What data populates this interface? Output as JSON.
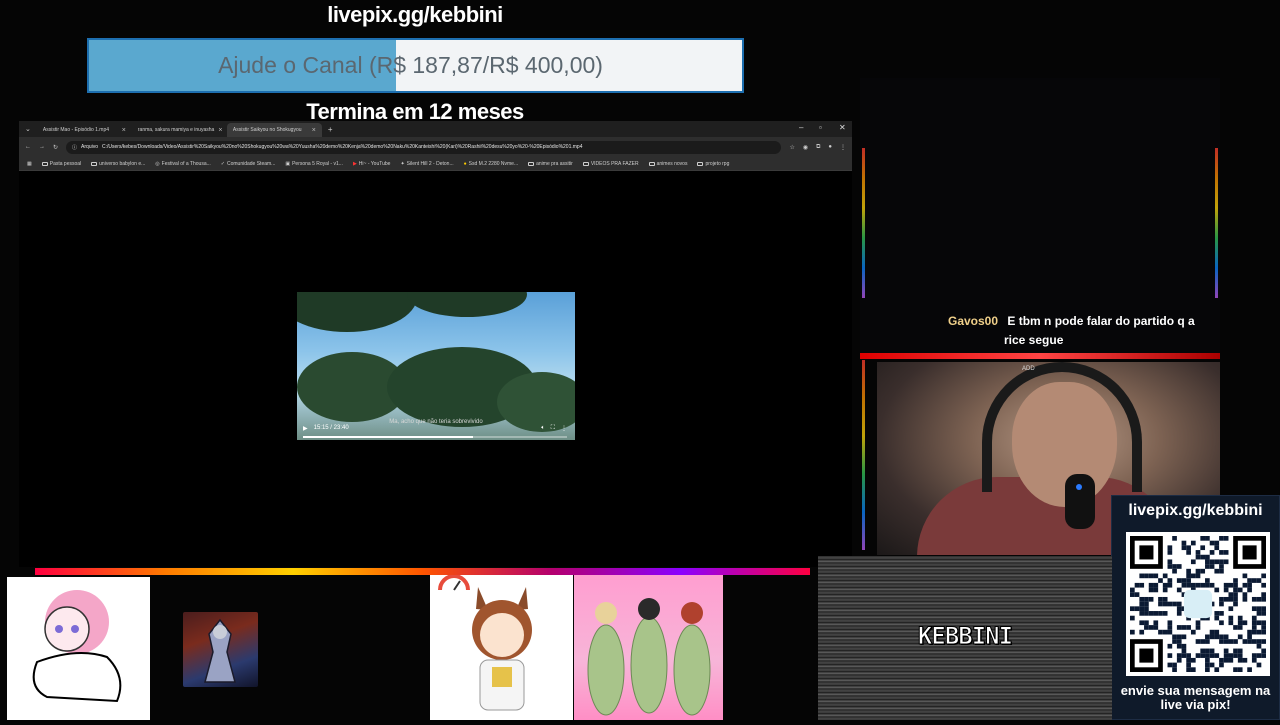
{
  "donation": {
    "url": "livepix.gg/kebbini",
    "goal_text": "Ajude o Canal (R$ 187,87/R$ 400,00)",
    "goal_current": 187.87,
    "goal_target": 400.0,
    "deadline": "Termina em 12 meses"
  },
  "browser": {
    "tabs": [
      {
        "label": "Assistir Mao - Episódio 1.mp4",
        "active": false
      },
      {
        "label": "ranma, sakura mamiya e inuyasha",
        "active": false
      },
      {
        "label": "Assistir Saikyou no Shokugyou",
        "active": true
      }
    ],
    "new_tab": "+",
    "address_prefix": "Arquivo",
    "address": "C:/Users/kebes/Downloads/Video/Assistir%20Saikyou%20no%20Shokugyou%20wa%20Yuusha%20demo%20Kenja%20demo%20Naku%20Kanteishi%20(Kari)%20Rashii%20desu%20yo%20-%20Episódio%201.mp4",
    "bookmarks": [
      "Pasta pessoal",
      "universo babylon e...",
      "Festival of a Thousa...",
      "Comunidade Steam...",
      "Persona 5 Royal - v1...",
      "Hi~ - YouTube",
      "Silent Hill 2 - Deton...",
      "Ssd M.2 2280 Nvme...",
      "anime pra assitir",
      "VIDEOS PRA FAZER",
      "animes novos",
      "projeto rpg"
    ]
  },
  "video": {
    "time": "15:15 / 23:40",
    "progress": 0.644,
    "subtitle": "Ma, acho que não teria sobrevivido"
  },
  "chat": {
    "username": "Gavos00",
    "message_line1": "E tbm n pode falar do partido q a",
    "message_line2": "rice segue"
  },
  "webcam": {
    "label": "ADD"
  },
  "qr": {
    "url": "livepix.gg/kebbini",
    "cta": "envie sua mensagem na live via pix!"
  },
  "channel": {
    "name": "KEBBINI"
  },
  "colors": {
    "goal_fill": "#5aa8cf",
    "goal_border": "#1d6fb0",
    "chat_username": "#f0d08a",
    "cam_border": "#dd0000"
  }
}
